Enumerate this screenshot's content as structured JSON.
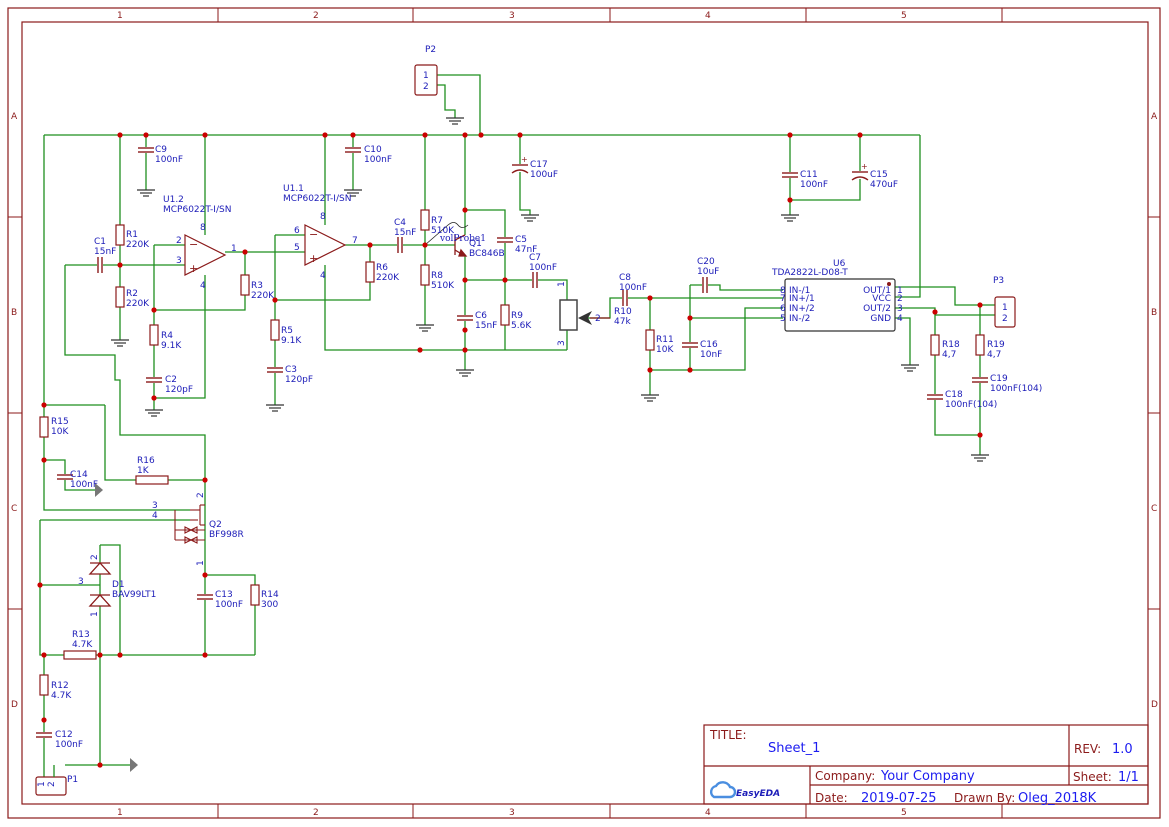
{
  "colors": {
    "wire": "#1f8f1f",
    "component": "#8b1a1a",
    "text": "#1c1cb8",
    "junction": "#cc0000",
    "frame": "#8b1a1a",
    "logo": "#4a8ee0"
  },
  "frame": {
    "columns": [
      "1",
      "2",
      "3",
      "4",
      "5"
    ],
    "rows": [
      "A",
      "B",
      "C",
      "D"
    ]
  },
  "title_block": {
    "title_label": "TITLE:",
    "title": "Sheet_1",
    "rev_label": "REV:",
    "rev": "1.0",
    "company_label": "Company:",
    "company": "Your Company",
    "sheet_label": "Sheet:",
    "sheet": "1/1",
    "date_label": "Date:",
    "date": "2019-07-25",
    "drawn_label": "Drawn By:",
    "drawn_by": "Oleg_2018K",
    "logo": "EasyEDA"
  },
  "components": [
    {
      "ref": "C9",
      "value": "100nF"
    },
    {
      "ref": "U1.2",
      "value": "MCP6022T-I/SN"
    },
    {
      "ref": "U1.1",
      "value": "MCP6022T-I/SN"
    },
    {
      "ref": "C1",
      "value": "15nF"
    },
    {
      "ref": "R1",
      "value": "220K"
    },
    {
      "ref": "R2",
      "value": "220K"
    },
    {
      "ref": "R3",
      "value": "220K"
    },
    {
      "ref": "R4",
      "value": "9.1K"
    },
    {
      "ref": "C2",
      "value": "120pF"
    },
    {
      "ref": "R5",
      "value": "9.1K"
    },
    {
      "ref": "C3",
      "value": "120pF"
    },
    {
      "ref": "C10",
      "value": "100nF"
    },
    {
      "ref": "R6",
      "value": "220K"
    },
    {
      "ref": "C4",
      "value": "15nF"
    },
    {
      "ref": "R7",
      "value": "510K"
    },
    {
      "ref": "R8",
      "value": "510K"
    },
    {
      "ref": "Q1",
      "value": "BC846B"
    },
    {
      "ref": "C5",
      "value": "47nF"
    },
    {
      "ref": "C7",
      "value": "100nF"
    },
    {
      "ref": "C6",
      "value": "15nF"
    },
    {
      "ref": "R9",
      "value": "5.6K"
    },
    {
      "ref": "C17",
      "value": "100uF"
    },
    {
      "ref": "P2",
      "value": ""
    },
    {
      "ref": "C8",
      "value": "100nF"
    },
    {
      "ref": "R10",
      "value": "47k"
    },
    {
      "ref": "R11",
      "value": "10K"
    },
    {
      "ref": "C20",
      "value": "10uF"
    },
    {
      "ref": "C16",
      "value": "10nF"
    },
    {
      "ref": "U6",
      "value": "TDA2822L-D08-T"
    },
    {
      "ref": "C11",
      "value": "100nF"
    },
    {
      "ref": "C15",
      "value": "470uF"
    },
    {
      "ref": "P3",
      "value": ""
    },
    {
      "ref": "R18",
      "value": "4,7"
    },
    {
      "ref": "R19",
      "value": "4,7"
    },
    {
      "ref": "C18",
      "value": "100nF(104)"
    },
    {
      "ref": "C19",
      "value": "100nF(104)"
    },
    {
      "ref": "R15",
      "value": "10K"
    },
    {
      "ref": "C14",
      "value": "100nF"
    },
    {
      "ref": "R16",
      "value": "1K"
    },
    {
      "ref": "Q2",
      "value": "BF998R"
    },
    {
      "ref": "D1",
      "value": "BAV99LT1"
    },
    {
      "ref": "C13",
      "value": "100nF"
    },
    {
      "ref": "R14",
      "value": "300"
    },
    {
      "ref": "R13",
      "value": "4.7K"
    },
    {
      "ref": "R12",
      "value": "4.7K"
    },
    {
      "ref": "C12",
      "value": "100nF"
    },
    {
      "ref": "P1",
      "value": ""
    }
  ],
  "pins": [
    "2",
    "3",
    "1",
    "8",
    "4",
    "6",
    "5",
    "7",
    "8",
    "4",
    "1",
    "2",
    "3",
    "8",
    "7",
    "6",
    "5",
    "1",
    "2",
    "3",
    "4",
    "2",
    "3",
    "4",
    "1",
    "2",
    "3",
    "1"
  ],
  "u6_pin_names": [
    "IN-/1",
    "IN+/1",
    "IN+/2",
    "IN-/2",
    "OUT/1",
    "VCC",
    "OUT/2",
    "GND"
  ],
  "connector_pins": {
    "p2": [
      "1",
      "2"
    ],
    "p3": [
      "1",
      "2"
    ],
    "p1": [
      "1",
      "2"
    ]
  },
  "opamp_signs": {
    "minus": "−",
    "plus": "+"
  },
  "probe": {
    "label": "volProbe1"
  }
}
